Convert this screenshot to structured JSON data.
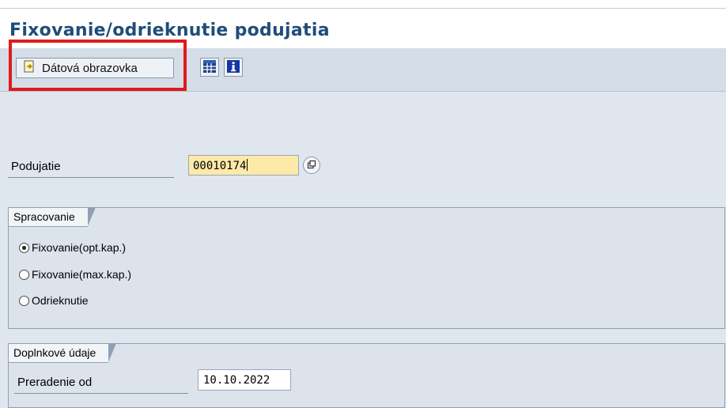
{
  "window": {
    "title": "Fixovanie/odrieknutie podujatia"
  },
  "toolbar": {
    "data_screen_label": "Dátová obrazovka",
    "icons": [
      "enter-document-icon",
      "table-layout-icon",
      "info-icon"
    ]
  },
  "form": {
    "podujatie": {
      "label": "Podujatie",
      "value": "00010174"
    },
    "spracovanie": {
      "title": "Spracovanie",
      "options": [
        {
          "label": "Fixovanie(opt.kap.)",
          "selected": true
        },
        {
          "label": "Fixovanie(max.kap.)",
          "selected": false
        },
        {
          "label": "Odrieknutie",
          "selected": false
        }
      ]
    },
    "doplnkove": {
      "title": "Doplnkové údaje",
      "preradenie_label": "Preradenie od",
      "preradenie_value": "10.10.2022"
    }
  },
  "colors": {
    "title": "#1f4d7a",
    "highlight": "#e01b1b",
    "required_field": "#fde9a8"
  }
}
